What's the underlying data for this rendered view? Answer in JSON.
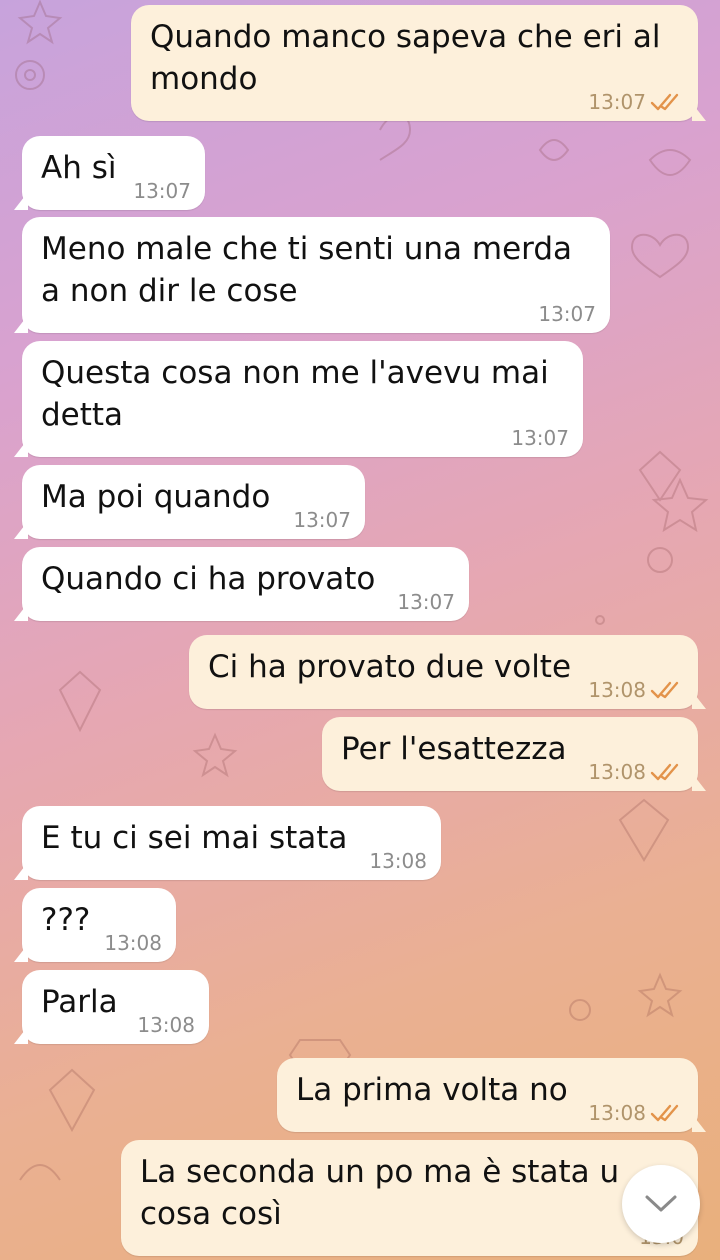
{
  "wallpaper": {
    "pattern": "doodle-pattern",
    "colors": [
      "#c7a3dc",
      "#e6a7b2",
      "#e9b07c"
    ]
  },
  "theme": {
    "incoming_bg": "#ffffff",
    "outgoing_bg": "#fdf0db",
    "check_color": "#e3934a"
  },
  "messages": [
    {
      "direction": "out",
      "text": "Quando manco sapeva che eri al\nmondo",
      "time": "13:07",
      "status": "read"
    },
    {
      "direction": "in",
      "text": "Ah sì",
      "time": "13:07"
    },
    {
      "direction": "in",
      "text": "Meno male che ti senti una merda\na non dir le cose",
      "time": "13:07"
    },
    {
      "direction": "in",
      "text": "Questa cosa non me l'avevu mai\ndetta",
      "time": "13:07"
    },
    {
      "direction": "in",
      "text": "Ma poi quando",
      "time": "13:07"
    },
    {
      "direction": "in",
      "text": "Quando ci ha provato",
      "time": "13:07"
    },
    {
      "direction": "out",
      "text": "Ci ha provato due volte",
      "time": "13:08",
      "status": "read"
    },
    {
      "direction": "out",
      "text": "Per l'esattezza",
      "time": "13:08",
      "status": "read"
    },
    {
      "direction": "in",
      "text": "E tu ci sei mai stata",
      "time": "13:08"
    },
    {
      "direction": "in",
      "text": "???",
      "time": "13:08"
    },
    {
      "direction": "in",
      "text": "Parla",
      "time": "13:08"
    },
    {
      "direction": "out",
      "text": "La prima volta no",
      "time": "13:08",
      "status": "read"
    },
    {
      "direction": "out",
      "text": "La seconda un po ma è stata u\ncosa così",
      "time": "13:0",
      "status": "read"
    }
  ],
  "scroll_down_button": {
    "icon": "chevron-down-icon"
  }
}
